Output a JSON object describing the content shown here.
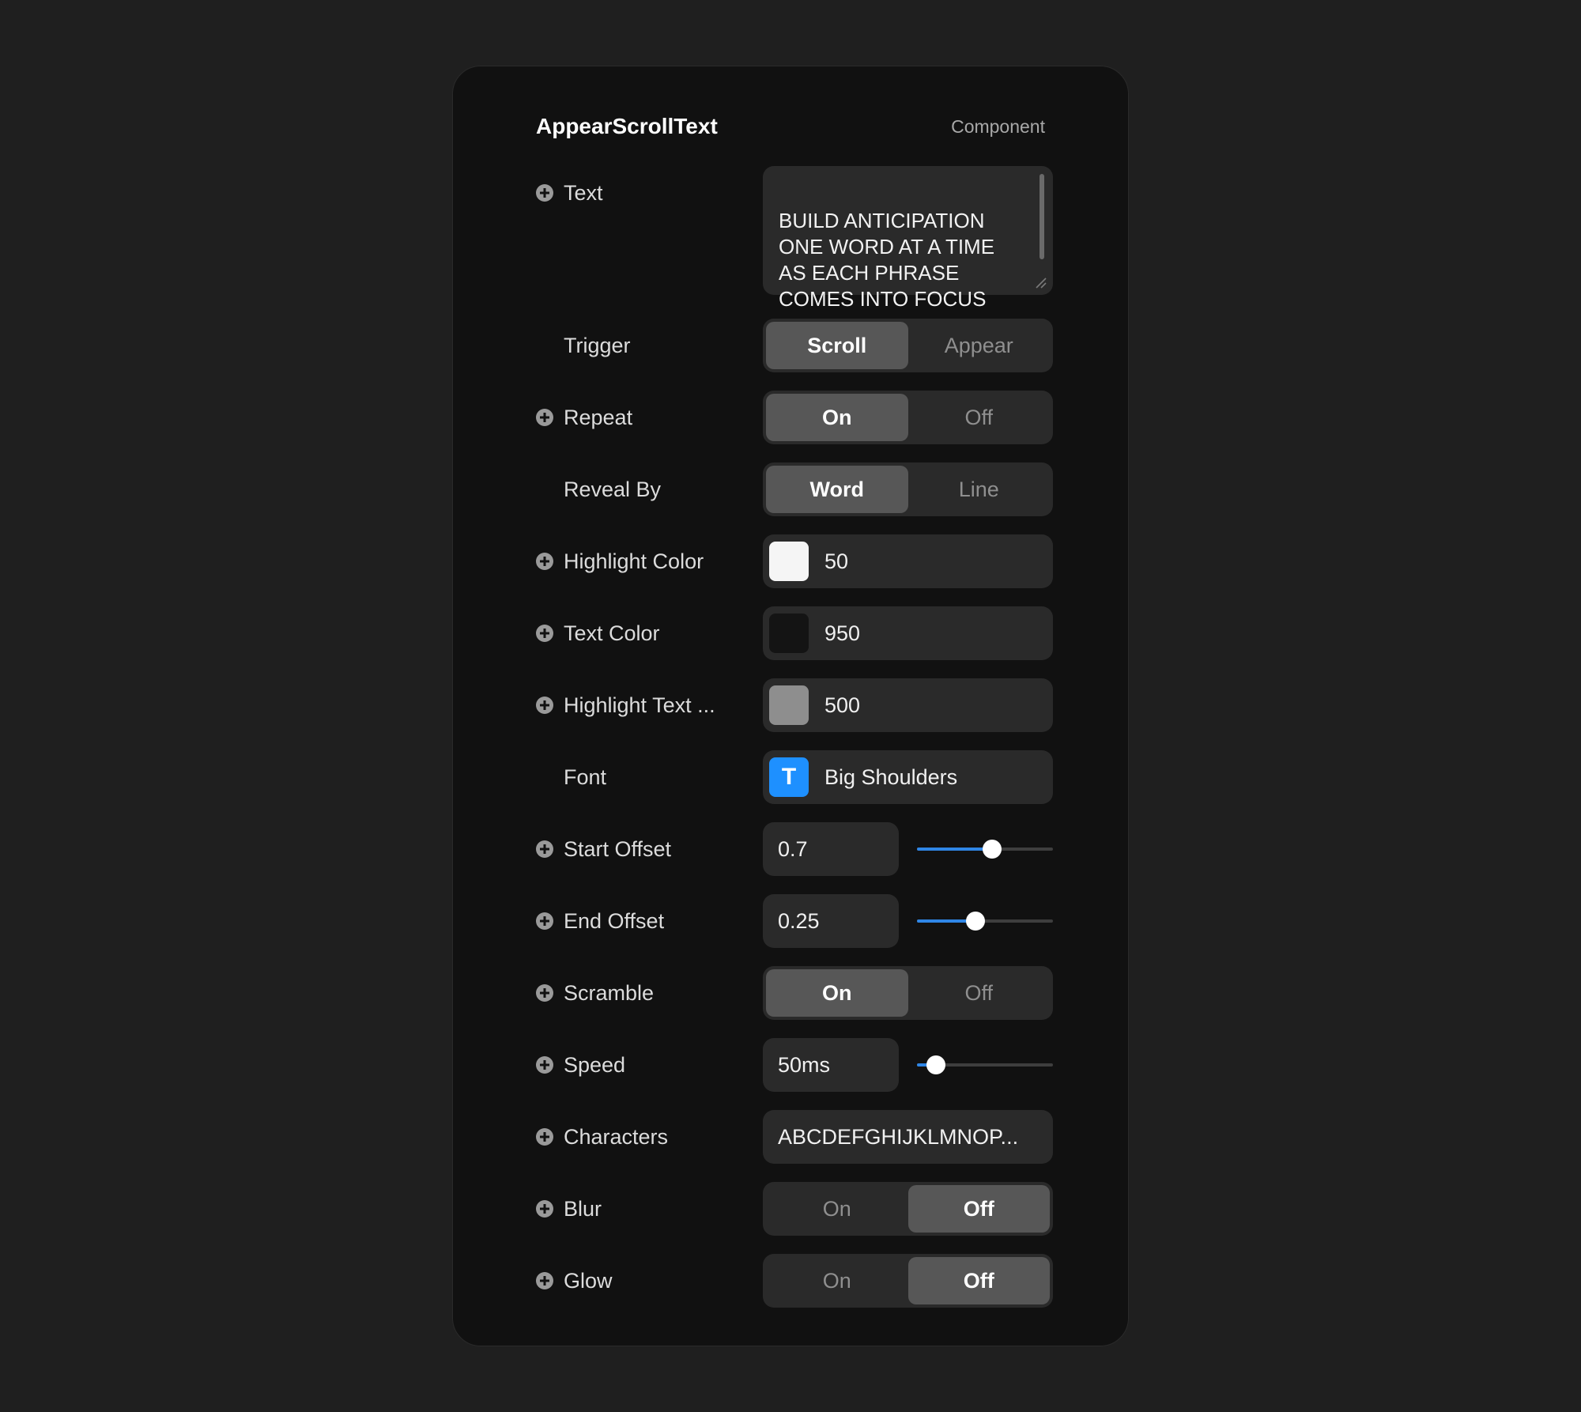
{
  "panel": {
    "title": "AppearScrollText",
    "subtitle": "Component"
  },
  "props": {
    "text": {
      "label": "Text",
      "value": "BUILD ANTICIPATION\nONE WORD AT A TIME\nAS EACH PHRASE\nCOMES INTO FOCUS"
    },
    "trigger": {
      "label": "Trigger",
      "options": [
        "Scroll",
        "Appear"
      ],
      "selected": "Scroll"
    },
    "repeat": {
      "label": "Repeat",
      "options": [
        "On",
        "Off"
      ],
      "selected": "On"
    },
    "reveal_by": {
      "label": "Reveal By",
      "options": [
        "Word",
        "Line"
      ],
      "selected": "Word"
    },
    "highlight_color": {
      "label": "Highlight Color",
      "value": "50",
      "swatch": "#f5f5f5"
    },
    "text_color": {
      "label": "Text Color",
      "value": "950",
      "swatch": "#141414"
    },
    "highlight_text_color": {
      "label": "Highlight Text ...",
      "value": "500",
      "swatch": "#8e8e8e"
    },
    "font": {
      "label": "Font",
      "value": "Big Shoulders",
      "icon": "text-font-icon",
      "icon_glyph": "T",
      "icon_color": "#1e90ff"
    },
    "start_offset": {
      "label": "Start Offset",
      "value": "0.7",
      "slider_fraction": 0.55
    },
    "end_offset": {
      "label": "End Offset",
      "value": "0.25",
      "slider_fraction": 0.43
    },
    "scramble": {
      "label": "Scramble",
      "options": [
        "On",
        "Off"
      ],
      "selected": "On"
    },
    "speed": {
      "label": "Speed",
      "value": "50ms",
      "slider_fraction": 0.14
    },
    "characters": {
      "label": "Characters",
      "value": "ABCDEFGHIJKLMNOP..."
    },
    "blur": {
      "label": "Blur",
      "options": [
        "On",
        "Off"
      ],
      "selected": "Off"
    },
    "glow": {
      "label": "Glow",
      "options": [
        "On",
        "Off"
      ],
      "selected": "Off"
    }
  },
  "colors": {
    "accent": "#2f86e6",
    "panel_bg": "#111111",
    "control_bg": "#2a2a2a",
    "active_segment": "#575757"
  }
}
